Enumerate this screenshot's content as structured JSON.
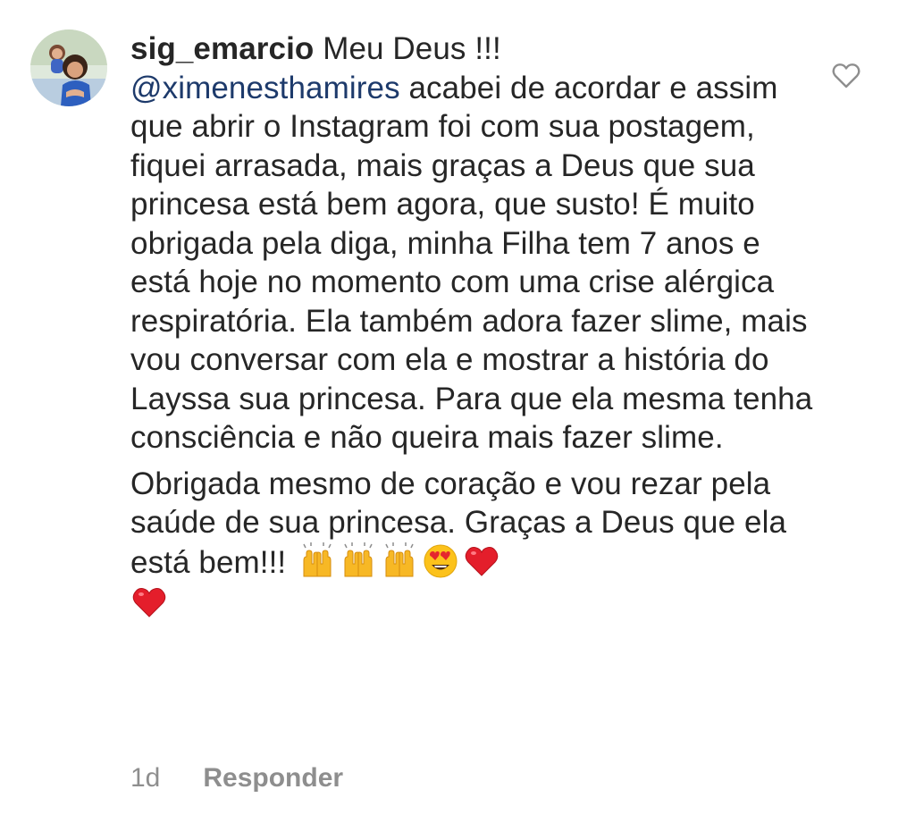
{
  "comment": {
    "username": "sig_emarcio",
    "first_line": "Meu Deus !!!",
    "mention": "@ximenesthamires",
    "paragraph1": " acabei de acordar e assim que abrir o Instagram foi com sua postagem, fiquei arrasada, mais graças a Deus que sua princesa está bem agora, que susto! É muito obrigada pela diga, minha Filha tem 7 anos e está hoje no momento com uma crise alérgica respiratória. Ela também adora fazer slime, mais vou conversar com ela e mostrar a história do Layssa sua princesa. Para que ela mesma tenha consciência e não queira mais fazer slime.",
    "paragraph2": "Obrigada mesmo de coração e vou rezar pela saúde de sua princesa. Graças a Deus que ela está bem!!! ",
    "emojis": [
      "raising-hands-emoji",
      "raising-hands-emoji",
      "raising-hands-emoji",
      "heart-eyes-emoji",
      "red-heart-emoji",
      "red-heart-emoji"
    ]
  },
  "footer": {
    "time": "1d",
    "reply_label": "Responder"
  },
  "icons": {
    "like": "heart-outline-icon"
  },
  "colors": {
    "text": "#262626",
    "mention": "#1d3a6b",
    "muted": "#8e8e8e"
  }
}
